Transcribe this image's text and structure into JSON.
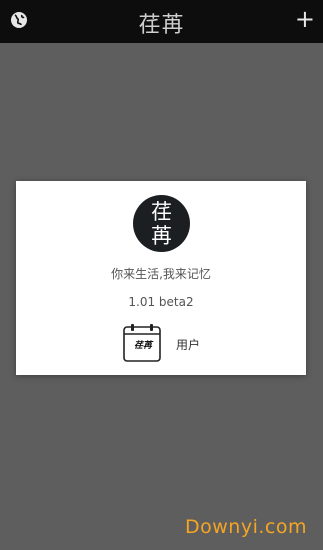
{
  "header": {
    "title": "荏苒",
    "globe_icon": "globe-icon",
    "add_label": "+",
    "add_icon": "plus-icon"
  },
  "about": {
    "logo_top": "荏",
    "logo_bottom": "苒",
    "slogan": "你来生活,我来记忆",
    "version": "1.01 beta2",
    "user_icon_text": "荏苒",
    "user_label": "用户"
  },
  "watermark": "Downyi.com",
  "colors": {
    "topbar": "#0d0d0d",
    "overlay": "#5e5e5e",
    "dialog": "#ffffff",
    "logo_bg": "#1b1f22",
    "watermark": "#f5a523"
  }
}
